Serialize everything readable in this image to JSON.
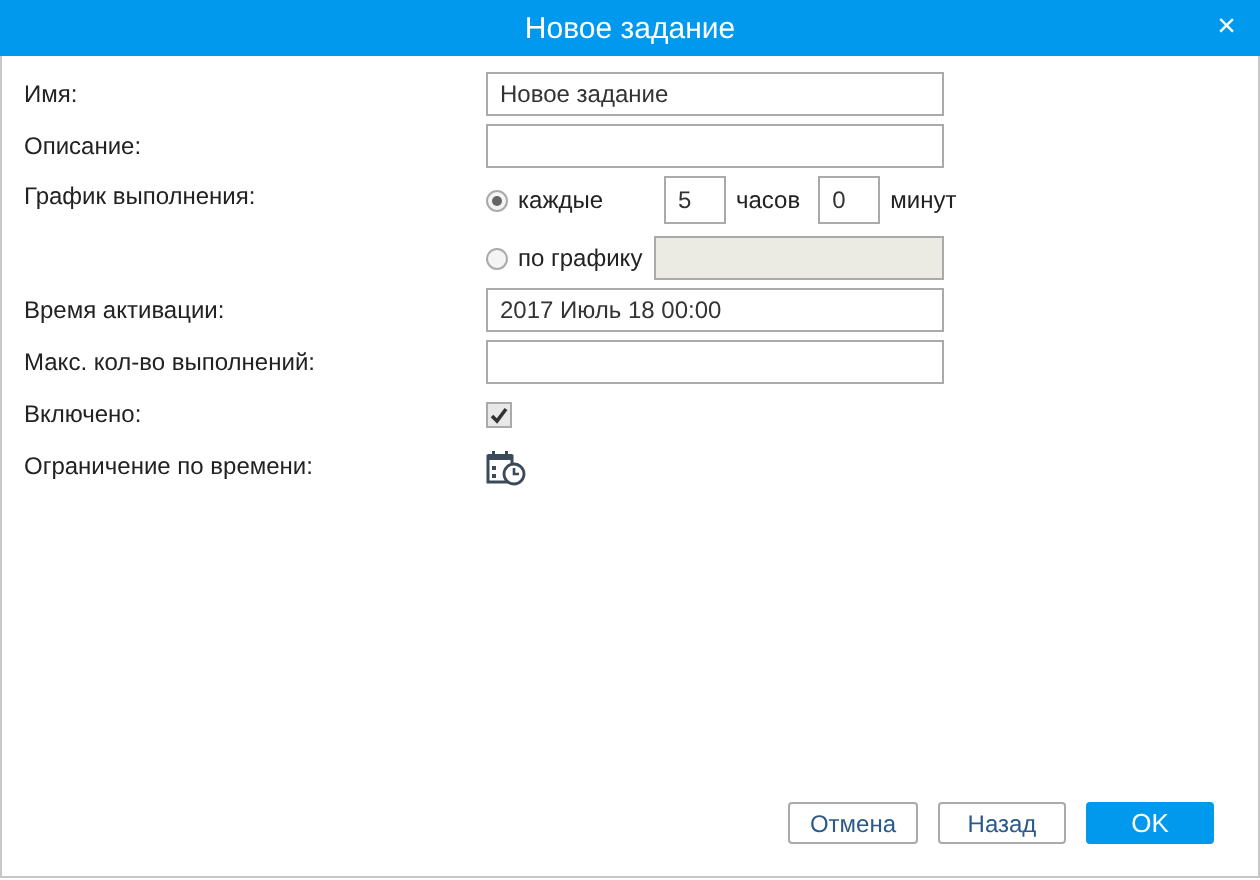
{
  "window": {
    "title": "Новое задание",
    "close": "×"
  },
  "name": {
    "label": "Имя:",
    "value": "Новое задание"
  },
  "description": {
    "label": "Описание:"
  },
  "schedule": {
    "label": "График выполнения:",
    "options": [
      {
        "kind": "interval",
        "label": "каждые",
        "selected": true,
        "hours": "5",
        "hours_unit": "часов",
        "minutes": "0",
        "minutes_unit": "минут"
      },
      {
        "kind": "custom",
        "label": "по графику",
        "selected": false,
        "disabled": true
      }
    ]
  },
  "activation": {
    "label": "Время активации:",
    "value": "2017 Июль 18 00:00"
  },
  "max_runs": {
    "label": "Макс. кол-во выполнений:"
  },
  "enabled": {
    "label": "Включено:",
    "checked": true
  },
  "time_limit": {
    "label": "Ограничение по времени:"
  },
  "buttons": [
    {
      "label": "Отмена",
      "kind": "secondary"
    },
    {
      "label": "Назад",
      "kind": "secondary"
    },
    {
      "label": "OK",
      "kind": "primary"
    }
  ]
}
